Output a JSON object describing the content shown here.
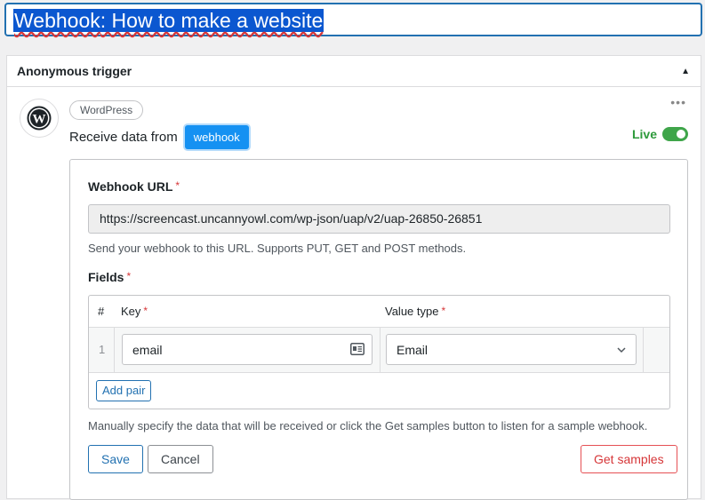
{
  "title": {
    "value": "Webhook: How to make a website",
    "underlined_part": "Webhook",
    "rest_part": ": How to make a website"
  },
  "panel": {
    "title": "Anonymous trigger",
    "caret": "▲",
    "more": "•••"
  },
  "trigger": {
    "integration": "WordPress",
    "sentence_prefix": "Receive data from",
    "token": "webhook",
    "status_label": "Live",
    "status_on": true
  },
  "form": {
    "url_label": "Webhook URL",
    "required_mark": "*",
    "url_value": "https://screencast.uncannyowl.com/wp-json/uap/v2/uap-26850-26851",
    "url_help": "Send your webhook to this URL. Supports PUT, GET and POST methods.",
    "fields_label": "Fields",
    "table": {
      "col_num": "#",
      "col_key": "Key",
      "col_value_type": "Value type",
      "rows": [
        {
          "num": "1",
          "key": "email",
          "value_type": "Email"
        }
      ],
      "add_pair": "Add pair"
    },
    "fields_help": "Manually specify the data that will be received or click the Get samples button to listen for a sample webhook.",
    "save": "Save",
    "cancel": "Cancel",
    "get_samples": "Get samples"
  },
  "colors": {
    "accent": "#2271b1",
    "token": "#1591f2",
    "live": "#2d9a3b",
    "danger": "#d63638"
  }
}
